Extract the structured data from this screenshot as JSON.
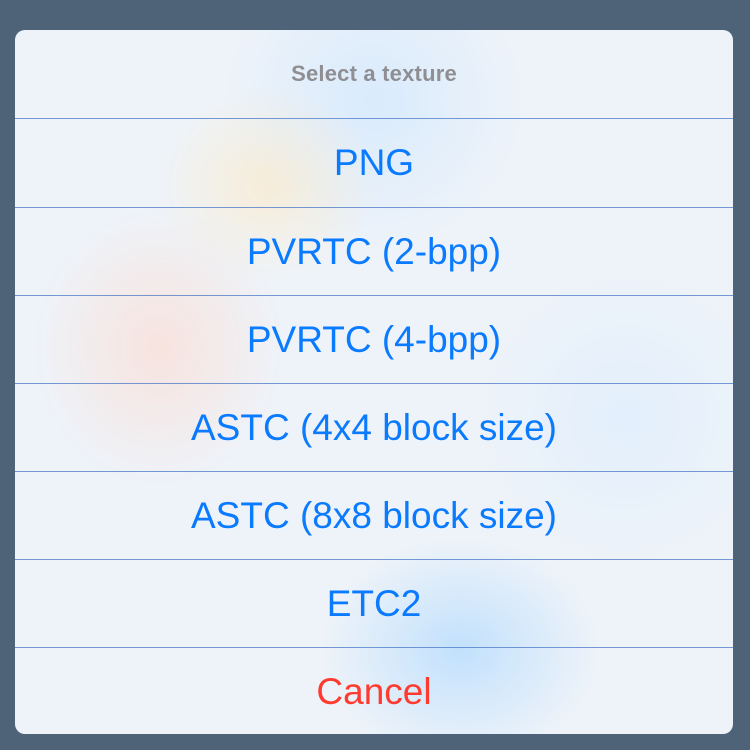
{
  "action_sheet": {
    "title": "Select a texture",
    "options": [
      {
        "label": "PNG"
      },
      {
        "label": "PVRTC (2-bpp)"
      },
      {
        "label": "PVRTC (4-bpp)"
      },
      {
        "label": "ASTC (4x4 block size)"
      },
      {
        "label": "ASTC (8x8 block size)"
      },
      {
        "label": "ETC2"
      }
    ],
    "cancel_label": "Cancel"
  },
  "colors": {
    "backdrop": "#4e6378",
    "option_text": "#0a7aff",
    "cancel_text": "#ff3b30",
    "title_text": "#8e8e93",
    "separator": "#4a78c8"
  }
}
